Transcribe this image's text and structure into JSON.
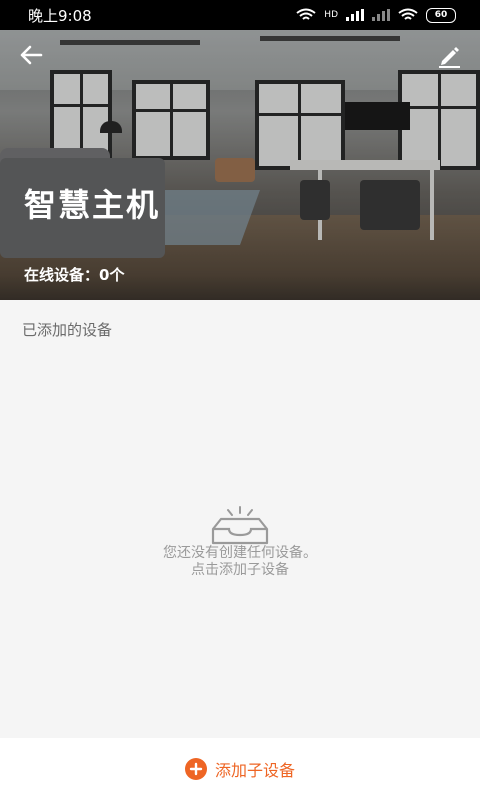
{
  "status_bar": {
    "time": "晚上9:08",
    "signal_hd": "HD",
    "battery": "60"
  },
  "header": {
    "back_icon": "arrow-left-icon",
    "edit_icon": "pencil-icon",
    "title": "智慧主机",
    "online_count": "在线设备：0个"
  },
  "main": {
    "section_label": "已添加的设备",
    "empty_icon": "empty-tray-icon",
    "empty_line1": "您还没有创建任何设备。",
    "empty_line2": "点击添加子设备"
  },
  "footer": {
    "add_icon": "plus-circle-icon",
    "add_label": "添加子设备",
    "accent_color": "#ee6524"
  }
}
